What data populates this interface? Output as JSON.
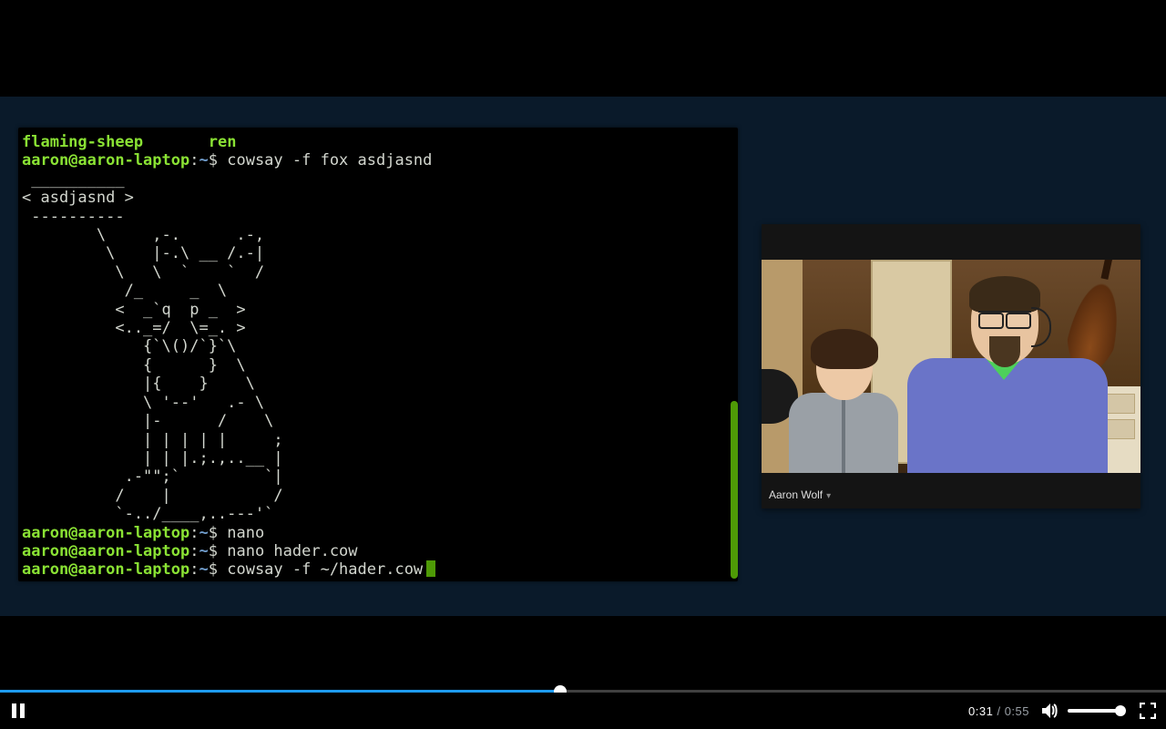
{
  "terminal": {
    "header_left": "flaming-sheep",
    "header_right": "ren",
    "prompt_user": "aaron@aaron-laptop",
    "prompt_sep": ":",
    "prompt_path": "~",
    "prompt_sym": "$",
    "cmd1": "cowsay -f fox asdjasnd",
    "bubble_top": " __________",
    "bubble_mid": "< asdjasnd >",
    "bubble_bot": " ----------",
    "art": [
      "        \\     ,-.      .-,",
      "         \\    |-.\\ __ /.-|",
      "          \\   \\  `    `  /",
      "           /_     _  \\",
      "          <  _`q  p _  >",
      "          <.._=/  \\=_. >",
      "             {`\\()/`}`\\",
      "             {      }  \\",
      "             |{    }    \\",
      "             \\ '--'   .- \\",
      "             |-      /    \\",
      "             | | | | |     ;",
      "             | | |.;.,..__ |",
      "           .-\"\";`         `|",
      "          /    |           /",
      "          `-../____,..---'`"
    ],
    "cmd2": "nano",
    "cmd3": "nano hader.cow",
    "cmd4": "cowsay -f ~/hader.cow"
  },
  "webcam": {
    "caption": "Aaron Wolf"
  },
  "player": {
    "current": "0:31",
    "duration": "0:55",
    "played_seconds": 31,
    "total_seconds": 55
  }
}
